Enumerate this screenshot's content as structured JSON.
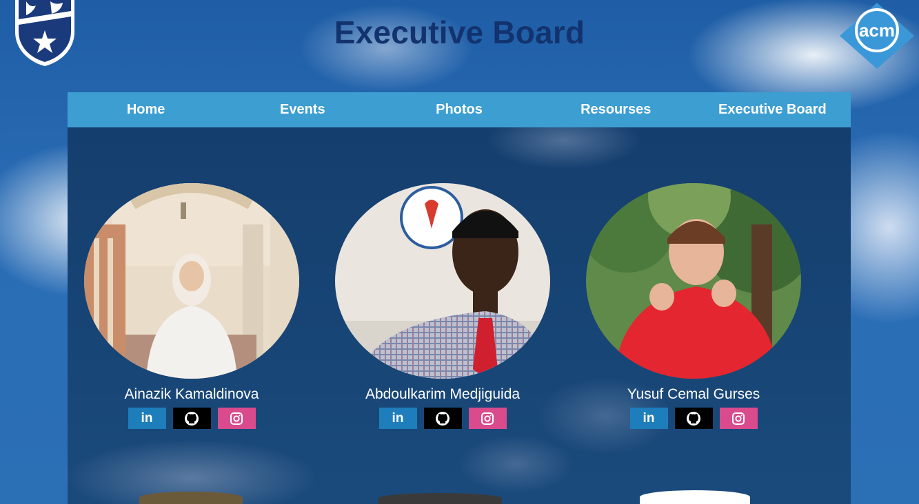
{
  "header": {
    "title": "Executive Board",
    "left_logo": "university-shield-icon",
    "right_logo": "acm-logo-icon",
    "acm_text": "acm"
  },
  "nav": {
    "items": [
      {
        "label": "Home"
      },
      {
        "label": "Events"
      },
      {
        "label": "Photos"
      },
      {
        "label": "Resourses"
      },
      {
        "label": "Executive Board"
      }
    ]
  },
  "members": [
    {
      "name": "Ainazik Kamaldinova",
      "socials": {
        "linkedin": "in",
        "github": "github-icon",
        "instagram": "instagram-icon"
      }
    },
    {
      "name": "Abdoulkarim Medjiguida",
      "socials": {
        "linkedin": "in",
        "github": "github-icon",
        "instagram": "instagram-icon"
      }
    },
    {
      "name": "Yusuf Cemal Gurses",
      "socials": {
        "linkedin": "in",
        "github": "github-icon",
        "instagram": "instagram-icon"
      }
    }
  ],
  "colors": {
    "title": "#13336f",
    "nav_bg": "#3d9ed1",
    "panel_bg": "#174575",
    "linkedin": "#1e7dbb",
    "github": "#000000",
    "instagram": "#d94b8d"
  }
}
